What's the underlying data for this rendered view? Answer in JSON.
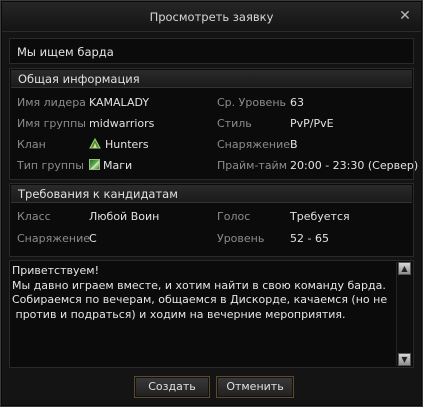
{
  "window": {
    "title": "Просмотреть заявку",
    "close_icon": "close-icon"
  },
  "request_title": "Мы ищем барда",
  "general_info": {
    "header": "Общая информация",
    "leader_label": "Имя лидера",
    "leader_value": "KAMALADY",
    "group_name_label": "Имя группы",
    "group_name_value": "midwarriors",
    "clan_label": "Клан",
    "clan_value": "Hunters",
    "clan_icon": "clan-emblem-icon",
    "group_type_label": "Тип группы",
    "group_type_value": "Маги",
    "group_type_icon": "mage-class-icon",
    "avg_level_label": "Ср. Уровень",
    "avg_level_value": "63",
    "style_label": "Стиль",
    "style_value": "PvP/PvE",
    "equipment_label": "Снаряжение",
    "equipment_value": "B",
    "prime_time_label": "Прайм-тайм",
    "prime_time_value": "20:00 - 23:30 (Сервер)"
  },
  "requirements": {
    "header": "Требования к кандидатам",
    "class_label": "Класс",
    "class_value": "Любой Воин",
    "voice_label": "Голос",
    "voice_value": "Требуется",
    "equipment_label": "Снаряжение",
    "equipment_value": "C",
    "level_label": "Уровень",
    "level_value": "52 - 65"
  },
  "message": "Приветствуем!\nМы давно играем вместе, и хотим найти в свою команду барда.\nСобираемся по вечерам, общаемся в Дискорде, качаемся (но не\n против и подраться) и ходим на вечерние мероприятия.",
  "buttons": {
    "create": "Создать",
    "cancel": "Отменить"
  }
}
